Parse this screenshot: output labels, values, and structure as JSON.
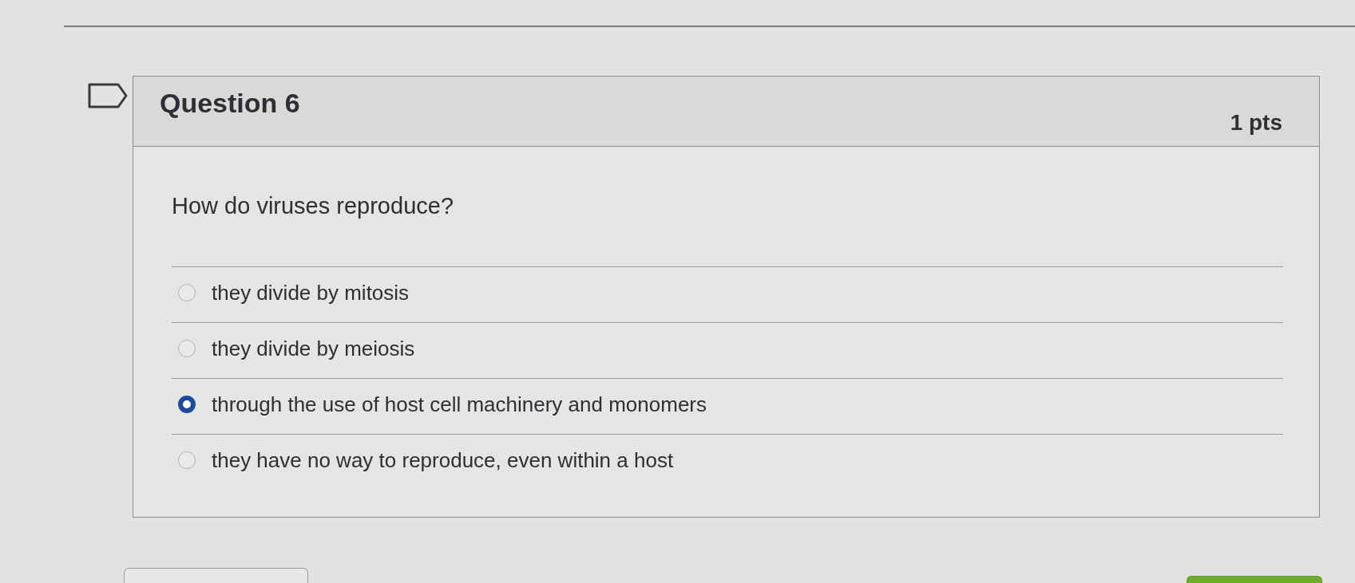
{
  "header": {
    "title": "Question 6",
    "points": "1 pts"
  },
  "question": {
    "prompt": "How do viruses reproduce?",
    "answers": [
      {
        "label": "they divide by mitosis",
        "selected": false
      },
      {
        "label": "they divide by meiosis",
        "selected": false
      },
      {
        "label": "through the use of host cell machinery and monomers",
        "selected": true
      },
      {
        "label": "they have no way to reproduce, even within a host",
        "selected": false
      }
    ]
  },
  "footer_buttons": [
    {
      "kind": "outlined"
    },
    {
      "kind": "filled"
    }
  ]
}
